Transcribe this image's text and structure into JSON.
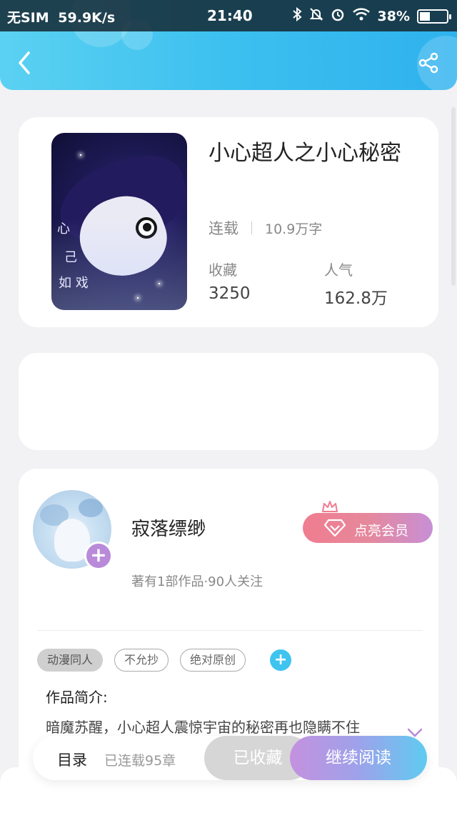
{
  "status_bar": {
    "carrier": "无SIM",
    "speed": "59.9K/s",
    "time": "21:40",
    "battery": "38%",
    "battery_level": 0.38,
    "icons": [
      "bluetooth-icon",
      "mute-bell-icon",
      "alarm-icon",
      "wifi-icon",
      "battery-icon"
    ]
  },
  "header": {
    "back_icon": "chevron-left-icon",
    "share_icon": "share-icon",
    "accent_color": "#3cc0ef"
  },
  "book": {
    "title": "小心超人之小心秘密",
    "status": "连载",
    "word_count": "10.9万字",
    "favorites_label": "收藏",
    "favorites_value": "3250",
    "popularity_label": "人气",
    "popularity_value": "162.8万",
    "cover_text": [
      "心",
      "己",
      "如 戏"
    ]
  },
  "author": {
    "name": "寂落缥缈",
    "info": "著有1部作品·90人关注",
    "follow_symbol": "+",
    "vip_label": "点亮会员"
  },
  "tags": [
    "动漫同人",
    "不允抄",
    "绝对原创"
  ],
  "add_tag_symbol": "+",
  "intro": {
    "title": "作品简介:",
    "text": "暗魔苏醒，小心超人震惊宇宙的秘密再也隐瞒不住"
  },
  "bottom_bar": {
    "toc_label": "目录",
    "chapters": "已连载95章",
    "favorited_label": "已收藏",
    "read_label": "继续阅读"
  }
}
